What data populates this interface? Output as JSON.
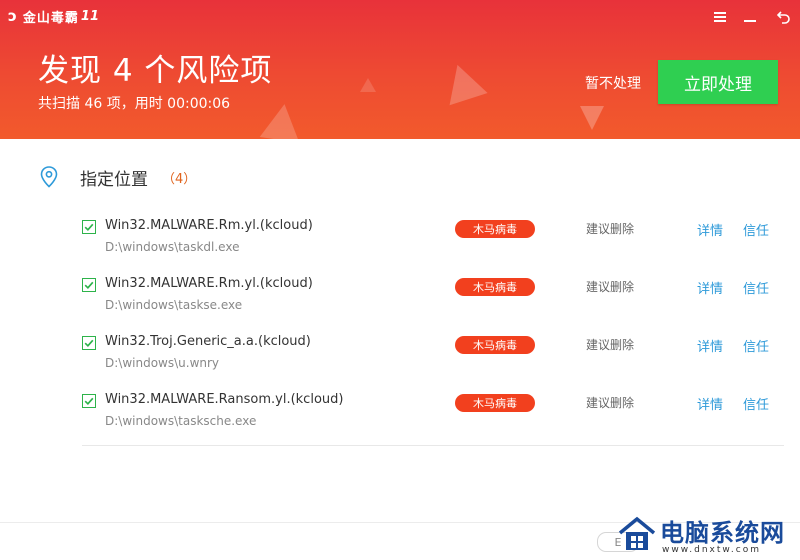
{
  "app": {
    "name": "金山毒霸",
    "version": "11",
    "logo_glyph": "ↄ"
  },
  "header": {
    "title": "发现 4 个风险项",
    "subtitle": "共扫描 46 项，用时 00:00:06",
    "ignore_label": "暂不处理",
    "fix_label": "立即处理",
    "accent_color": "#ee4b32",
    "button_color": "#2fcf51"
  },
  "window_controls": {
    "menu": "≡",
    "minimize": "—",
    "close": "×"
  },
  "group": {
    "label": "指定位置",
    "count": "（4）"
  },
  "threats": [
    {
      "name": "Win32.MALWARE.Rm.yl.(kcloud)",
      "path": "D:\\windows\\taskdl.exe",
      "tag": "木马病毒",
      "suggestion": "建议删除",
      "detail": "详情",
      "trust": "信任",
      "checked": true
    },
    {
      "name": "Win32.MALWARE.Rm.yl.(kcloud)",
      "path": "D:\\windows\\taskse.exe",
      "tag": "木马病毒",
      "suggestion": "建议删除",
      "detail": "详情",
      "trust": "信任",
      "checked": true
    },
    {
      "name": "Win32.Troj.Generic_a.a.(kcloud)",
      "path": "D:\\windows\\u.wnry",
      "tag": "木马病毒",
      "suggestion": "建议删除",
      "detail": "详情",
      "trust": "信任",
      "checked": true
    },
    {
      "name": "Win32.MALWARE.Ransom.yl.(kcloud)",
      "path": "D:\\windows\\tasksche.exe",
      "tag": "木马病毒",
      "suggestion": "建议删除",
      "detail": "详情",
      "trust": "信任",
      "checked": true
    }
  ],
  "footer": {
    "pill_text": "E"
  },
  "watermark": {
    "title": "电脑系统网",
    "url": "www.dnxtw.com"
  }
}
